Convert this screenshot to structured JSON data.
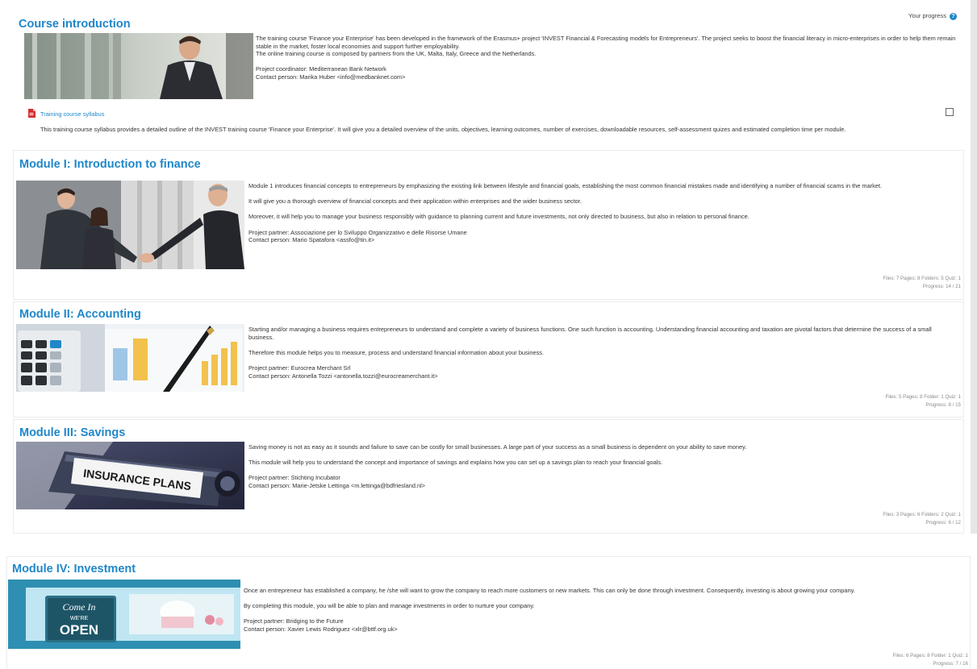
{
  "header": {
    "progress_label": "Your progress",
    "help_glyph": "?"
  },
  "colors": {
    "heading": "#1f87c9",
    "text": "#333333",
    "muted": "#8a8a8a",
    "card_border": "#ececec"
  },
  "intro": {
    "title": "Course introduction",
    "paragraphs": [
      "The training course 'Finance your Enterprise' has been developed in the framework of the Erasmus+ project 'INVEST Financial & Forecasting models for Entrepreneurs'. The project seeks to boost the financial literacy in micro-enterprises in order to help them remain stable in the market, foster local economies and support further employability.",
      "The online training course is composed by partners from the UK, Malta, Italy, Greece and the Netherlands."
    ],
    "coordinator": "Project coordinator: Mediterranean Bank Network",
    "contact": "Contact person: Marika Huber <info@medbanknet.com>",
    "syllabus": {
      "icon": "pdf-icon",
      "label": "Training course syllabus",
      "description": "This training course syllabus provides a detailed outline of the INVEST training course 'Finance your Enterprise'. It will give you a detailed overview of the units, objectives, learning outcomes, number of exercises, downloadable resources, self-assessment quizes and estimated completion time per module."
    }
  },
  "modules": [
    {
      "title": "Module I: Introduction to finance",
      "paragraphs": [
        "Module 1 introduces financial concepts to entrepreneurs by emphasizing the existing link between lifestyle and financial goals, establishing the most common financial mistakes made and identifying a number of financial scams in the market.",
        "It will give you a thorough overview of financial concepts and their application within enterprises and the wider business sector.",
        "Moreover, it will help you to manage your business responsibly  with guidance to planning current and future investments, not only directed to business, but also  in relation to personal finance."
      ],
      "partner": "Project partner: Associazione per lo Sviluppo Organizzativo e delle Risorse Umane",
      "contact": "Contact person: Mario Spatafora <assfo@tin.it>",
      "stats": "Files: 7  Pages: 8  Folders: 5  Quiz: 1",
      "progress": "Progress: 14 / 21"
    },
    {
      "title": "Module II: Accounting",
      "paragraphs": [
        "Starting and/or managing a business requires entrepreneurs to understand and complete a variety of business functions. One such function is accounting. Understanding financial accounting and taxation are pivotal  factors that determine the success of a small business.",
        "Therefore this module helps you to measure, process  and understand financial information about your business."
      ],
      "partner": "Project partner: Eurocrea Merchant Srl",
      "contact": "Contact person: Antonella Tozzi <antonella.tozzi@eurocreamerchant.it>",
      "stats": "Files: 5  Pages: 8  Folder: 1  Quiz: 1",
      "progress": "Progress: 8 / 15"
    },
    {
      "title": "Module III: Savings",
      "image_text": "INSURANCE PLANS",
      "paragraphs": [
        "Saving money is not as easy as it sounds and failure to save can be costly for small businesses. A large part of your success as a small business is dependent on your ability to save money.",
        "This module will help you to understand the concept and importance of savings and explains how you can set up a savings plan to reach your financial goals."
      ],
      "partner": "Project partner: Stichting Incubator",
      "contact": "Contact person: Marie-Jetske Lettinga <m.lettinga@bdfriesland.nl>",
      "stats": "Files: 3  Pages: 6  Folders: 2  Quiz: 1",
      "progress": "Progress: 6 / 12"
    },
    {
      "title": "Module IV: Investment",
      "image_text_1": "Come In",
      "image_text_2": "WE'RE",
      "image_text_3": "OPEN",
      "paragraphs": [
        "Once an entrepreneur has established a company, he /she will want to grow the company to reach more customers or new markets. This can only be done through investment. Consequently, investing is about growing your company.",
        "By completing this module, you will be able to plan and manage investments in order to nurture your company."
      ],
      "partner": "Project partner: Bridging to the Future",
      "contact": "Contact person: Xavier Lewis Rodriguez <xlr@bttf.org.uk>",
      "stats": "Files: 6  Pages: 8  Folder: 1  Quiz: 1",
      "progress": "Progress: 7 / 16"
    }
  ]
}
